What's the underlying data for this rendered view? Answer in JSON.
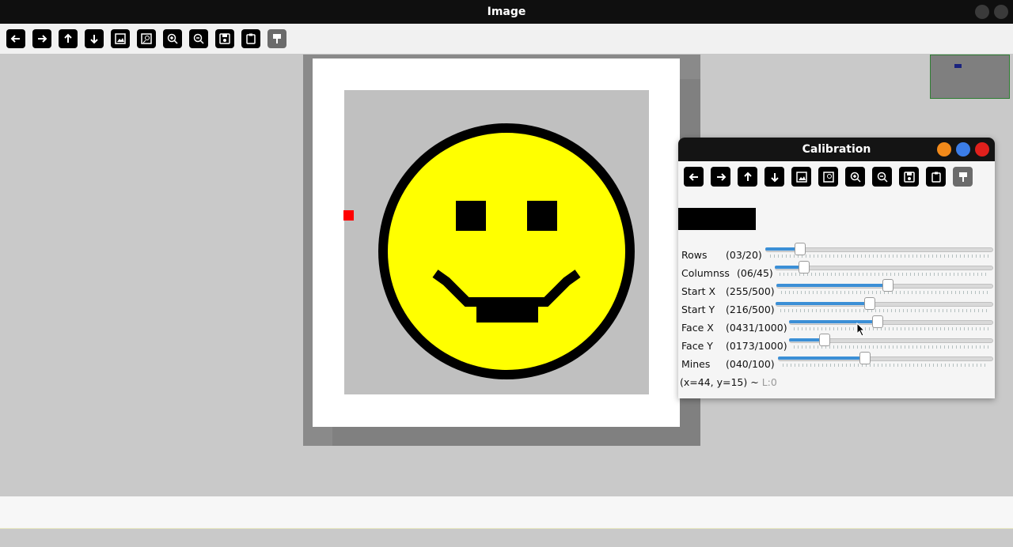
{
  "window": {
    "title": "Image"
  },
  "toolbar": {
    "icons": [
      "arrow-left-icon",
      "arrow-right-icon",
      "arrow-up-icon",
      "arrow-down-icon",
      "image-icon",
      "image-search-icon",
      "zoom-in-icon",
      "zoom-out-icon",
      "save-icon",
      "clipboard-icon",
      "paint-icon"
    ]
  },
  "dialog": {
    "title": "Calibration",
    "rows": [
      {
        "label": "Rows",
        "value": "(03/20)",
        "fraction": 0.15
      },
      {
        "label": "Columnss",
        "value": "(06/45)",
        "fraction": 0.13
      },
      {
        "label": "Start X",
        "value": "(255/500)",
        "fraction": 0.51
      },
      {
        "label": "Start Y",
        "value": "(216/500)",
        "fraction": 0.43
      },
      {
        "label": "Face X",
        "value": "(0431/1000)",
        "fraction": 0.43
      },
      {
        "label": "Face Y",
        "value": "(0173/1000)",
        "fraction": 0.17
      },
      {
        "label": "Mines",
        "value": "(040/100)",
        "fraction": 0.4
      }
    ],
    "status": "(x=44, y=15) ~",
    "level": "L:0"
  },
  "colors": {
    "accent": "#3b8fd6",
    "face": "#ffff00",
    "close_dot": "#e0201c",
    "minimize_dot": "#f28a1a",
    "maximize_dot": "#3b7de8"
  }
}
